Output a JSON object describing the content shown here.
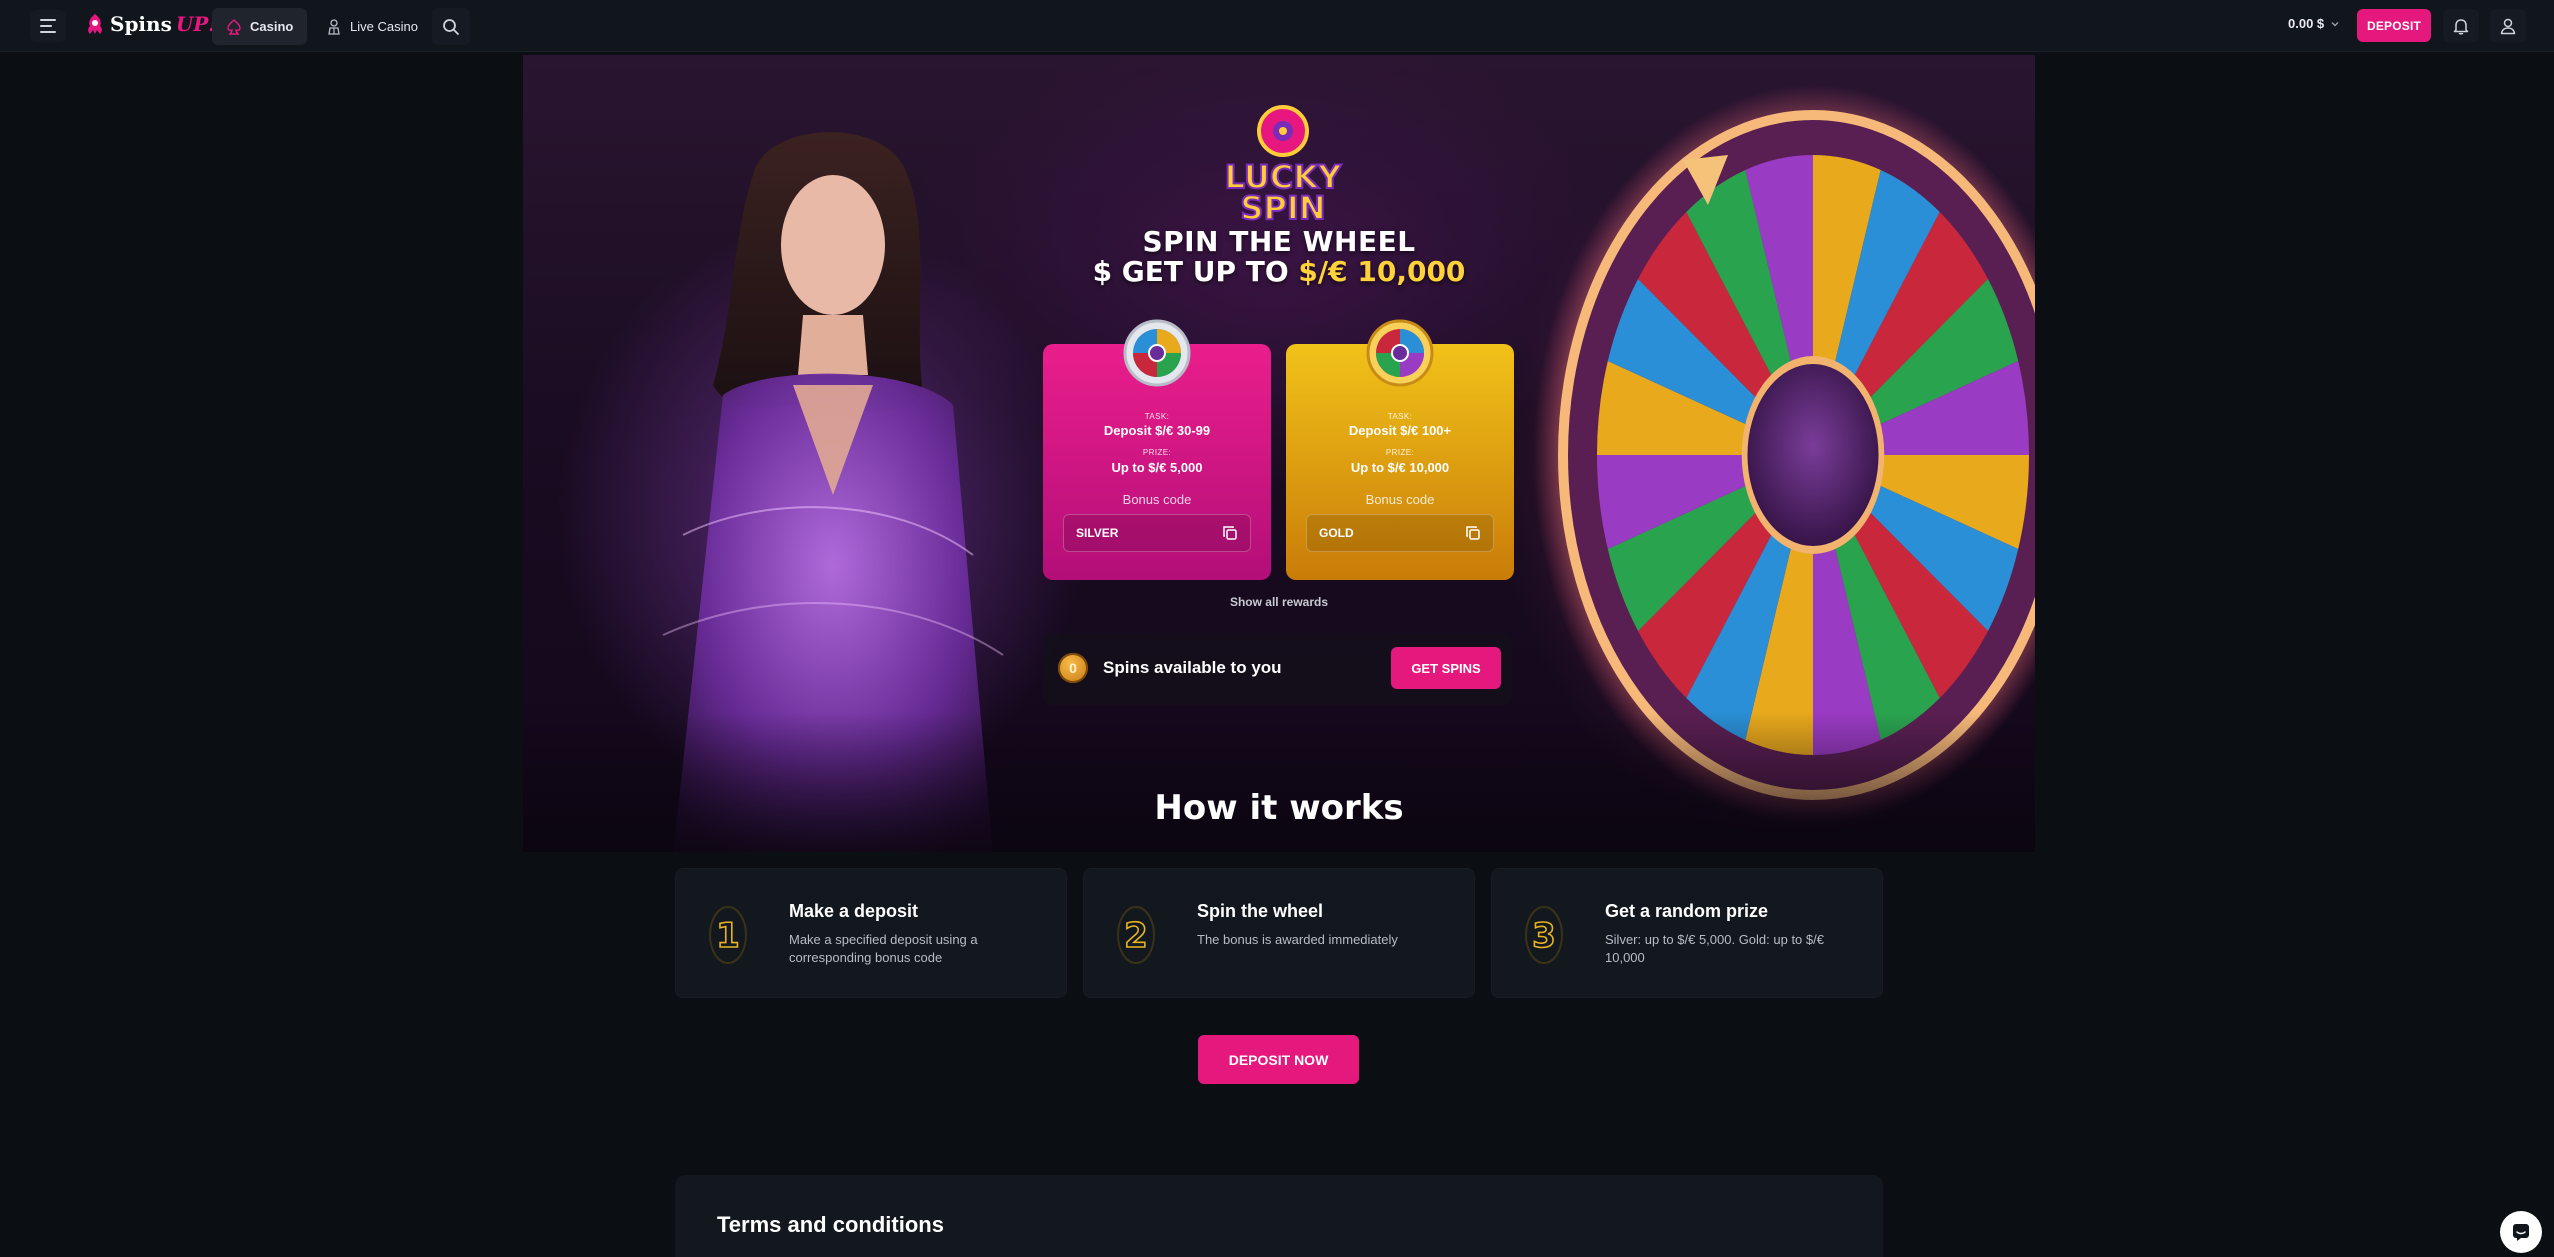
{
  "header": {
    "logo_main": "Spins",
    "logo_accent": "UP!",
    "nav": [
      {
        "label": "Casino",
        "icon": "spade-icon",
        "active": true
      },
      {
        "label": "Live Casino",
        "icon": "dealer-icon",
        "active": false
      }
    ],
    "balance": "0.00 $",
    "deposit_label": "DEPOSIT"
  },
  "hero": {
    "logo_line1": "LUCKY",
    "logo_line2": "SPIN",
    "title_line1": "SPIN THE WHEEL",
    "title_line2_prefix": "$ GET UP TO ",
    "title_line2_highlight": "$/€ 10,000",
    "cards": [
      {
        "name": "silver",
        "task_label": "TASK:",
        "task_value": "Deposit $/€ 30-99",
        "prize_label": "PRIZE:",
        "prize_value": "Up to $/€ 5,000",
        "bonus_label": "Bonus code",
        "code": "SILVER"
      },
      {
        "name": "gold",
        "task_label": "TASK:",
        "task_value": "Deposit $/€ 100+",
        "prize_label": "PRIZE:",
        "prize_value": "Up to $/€ 10,000",
        "bonus_label": "Bonus code",
        "code": "GOLD"
      }
    ],
    "show_all": "Show all rewards",
    "spins_count": "0",
    "spins_label": "Spins available to you",
    "get_spins": "GET SPINS",
    "how_title": "How it works"
  },
  "steps": [
    {
      "number": "1",
      "title": "Make a deposit",
      "desc": "Make a specified deposit using a corresponding bonus code"
    },
    {
      "number": "2",
      "title": "Spin the wheel",
      "desc": "The bonus is awarded immediately"
    },
    {
      "number": "3",
      "title": "Get a random prize",
      "desc": "Silver: up to $/€ 5,000. Gold: up to $/€ 10,000"
    }
  ],
  "deposit_now": "DEPOSIT NOW",
  "terms_title": "Terms and conditions",
  "colors": {
    "accent": "#e5197d",
    "gold": "#ffd23a",
    "background": "#0b0e13",
    "panel": "#13171e"
  }
}
